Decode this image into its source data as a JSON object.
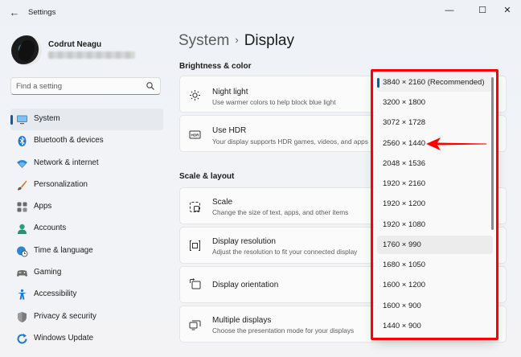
{
  "window": {
    "title": "Settings",
    "back": "←",
    "minimize": "—",
    "maximize": "☐",
    "close": "✕"
  },
  "profile": {
    "name": "Codrut Neagu"
  },
  "search": {
    "placeholder": "Find a setting"
  },
  "nav": [
    {
      "label": "System",
      "icon": "monitor-icon",
      "active": true
    },
    {
      "label": "Bluetooth & devices",
      "icon": "bluetooth-icon"
    },
    {
      "label": "Network & internet",
      "icon": "wifi-icon"
    },
    {
      "label": "Personalization",
      "icon": "brush-icon"
    },
    {
      "label": "Apps",
      "icon": "apps-icon"
    },
    {
      "label": "Accounts",
      "icon": "person-icon"
    },
    {
      "label": "Time & language",
      "icon": "globe-clock-icon"
    },
    {
      "label": "Gaming",
      "icon": "gamepad-icon"
    },
    {
      "label": "Accessibility",
      "icon": "accessibility-icon"
    },
    {
      "label": "Privacy & security",
      "icon": "shield-icon"
    },
    {
      "label": "Windows Update",
      "icon": "update-icon"
    }
  ],
  "header": {
    "parent": "System",
    "separator": "›",
    "current": "Display"
  },
  "sections": {
    "brightness": "Brightness & color",
    "scale_layout": "Scale & layout"
  },
  "cards": {
    "night_light": {
      "title": "Night light",
      "desc": "Use warmer colors to help block blue light",
      "icon": "sun-icon"
    },
    "hdr": {
      "title": "Use HDR",
      "desc": "Your display supports HDR games, videos, and apps",
      "icon": "hdr-icon"
    },
    "scale": {
      "title": "Scale",
      "desc": "Change the size of text, apps, and other items",
      "icon": "scale-icon"
    },
    "resolution": {
      "title": "Display resolution",
      "desc": "Adjust the resolution to fit your connected display",
      "icon": "resolution-icon"
    },
    "orientation": {
      "title": "Display orientation",
      "icon": "orientation-icon"
    },
    "multiple": {
      "title": "Multiple displays",
      "desc": "Choose the presentation mode for your displays",
      "icon": "multiple-displays-icon"
    }
  },
  "resolution_options": [
    "3840 × 2160 (Recommended)",
    "3200 × 1800",
    "3072 × 1728",
    "2560 × 1440",
    "2048 × 1536",
    "1920 × 2160",
    "1920 × 1200",
    "1920 × 1080",
    "1760 × 990",
    "1680 × 1050",
    "1600 × 1200",
    "1600 × 900",
    "1440 × 900"
  ],
  "selected_option": "3840 × 2160 (Recommended)",
  "hovered_option": "1760 × 990",
  "colors": {
    "accent": "#005fb8",
    "annotation": "#ff0000"
  }
}
